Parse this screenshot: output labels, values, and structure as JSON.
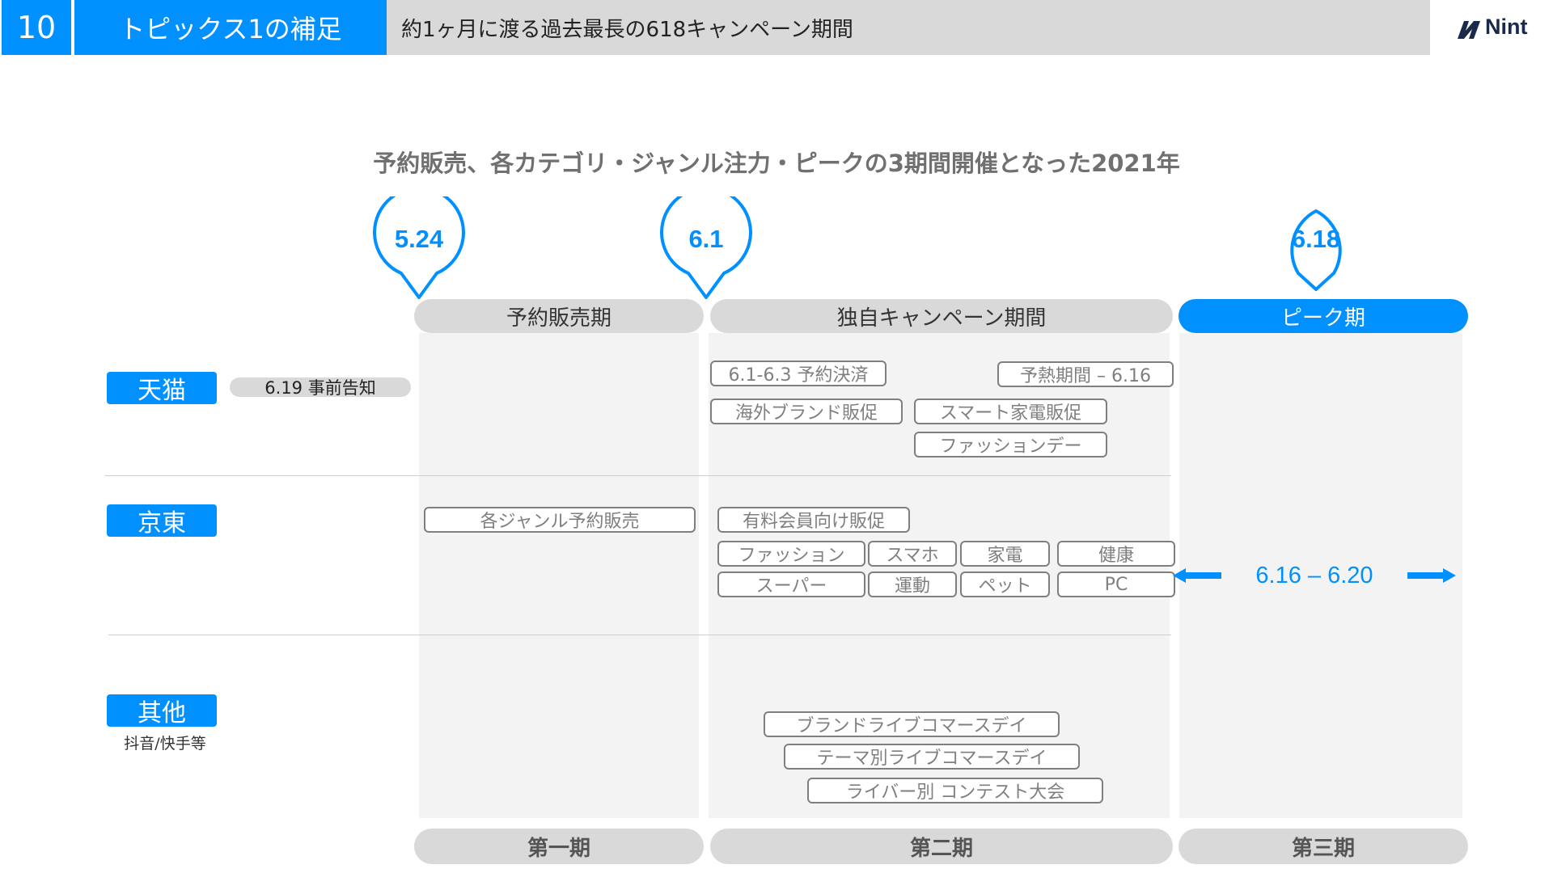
{
  "header": {
    "page_number": "10",
    "section": "トピックス1の補足",
    "subtitle": "約1ヶ月に渡る過去最長の618キャンペーン期間",
    "logo_text": "Nint"
  },
  "title": "予約販売、各カテゴリ・ジャンル注力・ピークの3期間開催となった2021年",
  "callouts": [
    "5.24",
    "6.1",
    "6.18"
  ],
  "phases": [
    "予約販売期",
    "独自キャンペーン期間",
    "ピーク期"
  ],
  "footer_phases": [
    "第一期",
    "第二期",
    "第三期"
  ],
  "rows": {
    "tmall": {
      "label": "天猫",
      "note": "6.19 事前告知",
      "tags": [
        "6.1-6.3 予約決済",
        "予熱期間 – 6.16",
        "海外ブランド販促",
        "スマート家電販促",
        "ファッションデー"
      ]
    },
    "jd": {
      "label": "京東",
      "tags": [
        "各ジャンル予約販売",
        "有料会員向け販促",
        "ファッション",
        "スマホ",
        "家電",
        "健康",
        "スーパー",
        "運動",
        "ペット",
        "PC"
      ],
      "peak_range": "6.16 – 6.20"
    },
    "other": {
      "label": "其他",
      "sublabel": "抖音/快手等",
      "tags": [
        "ブランドライブコマースデイ",
        "テーマ別ライブコマースデイ",
        "ライバー別 コンテスト大会"
      ]
    }
  },
  "colors": {
    "accent": "#0090ff",
    "phase_gray": "#d9d9d9",
    "tag_border": "#7f7f7f",
    "column_bg": "#f3f3f3"
  }
}
